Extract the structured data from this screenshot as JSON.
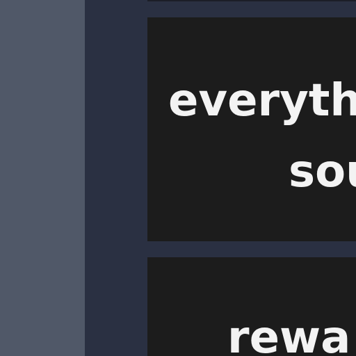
{
  "panels": [
    {
      "lines": [
        "everyth",
        "sou"
      ]
    },
    {
      "lines": [
        "rewa"
      ]
    }
  ],
  "colors": {
    "left_pane": "#505868",
    "main_background": "#2a3042",
    "panel_background": "#1c1c1c",
    "text": "#f3f3f3"
  }
}
